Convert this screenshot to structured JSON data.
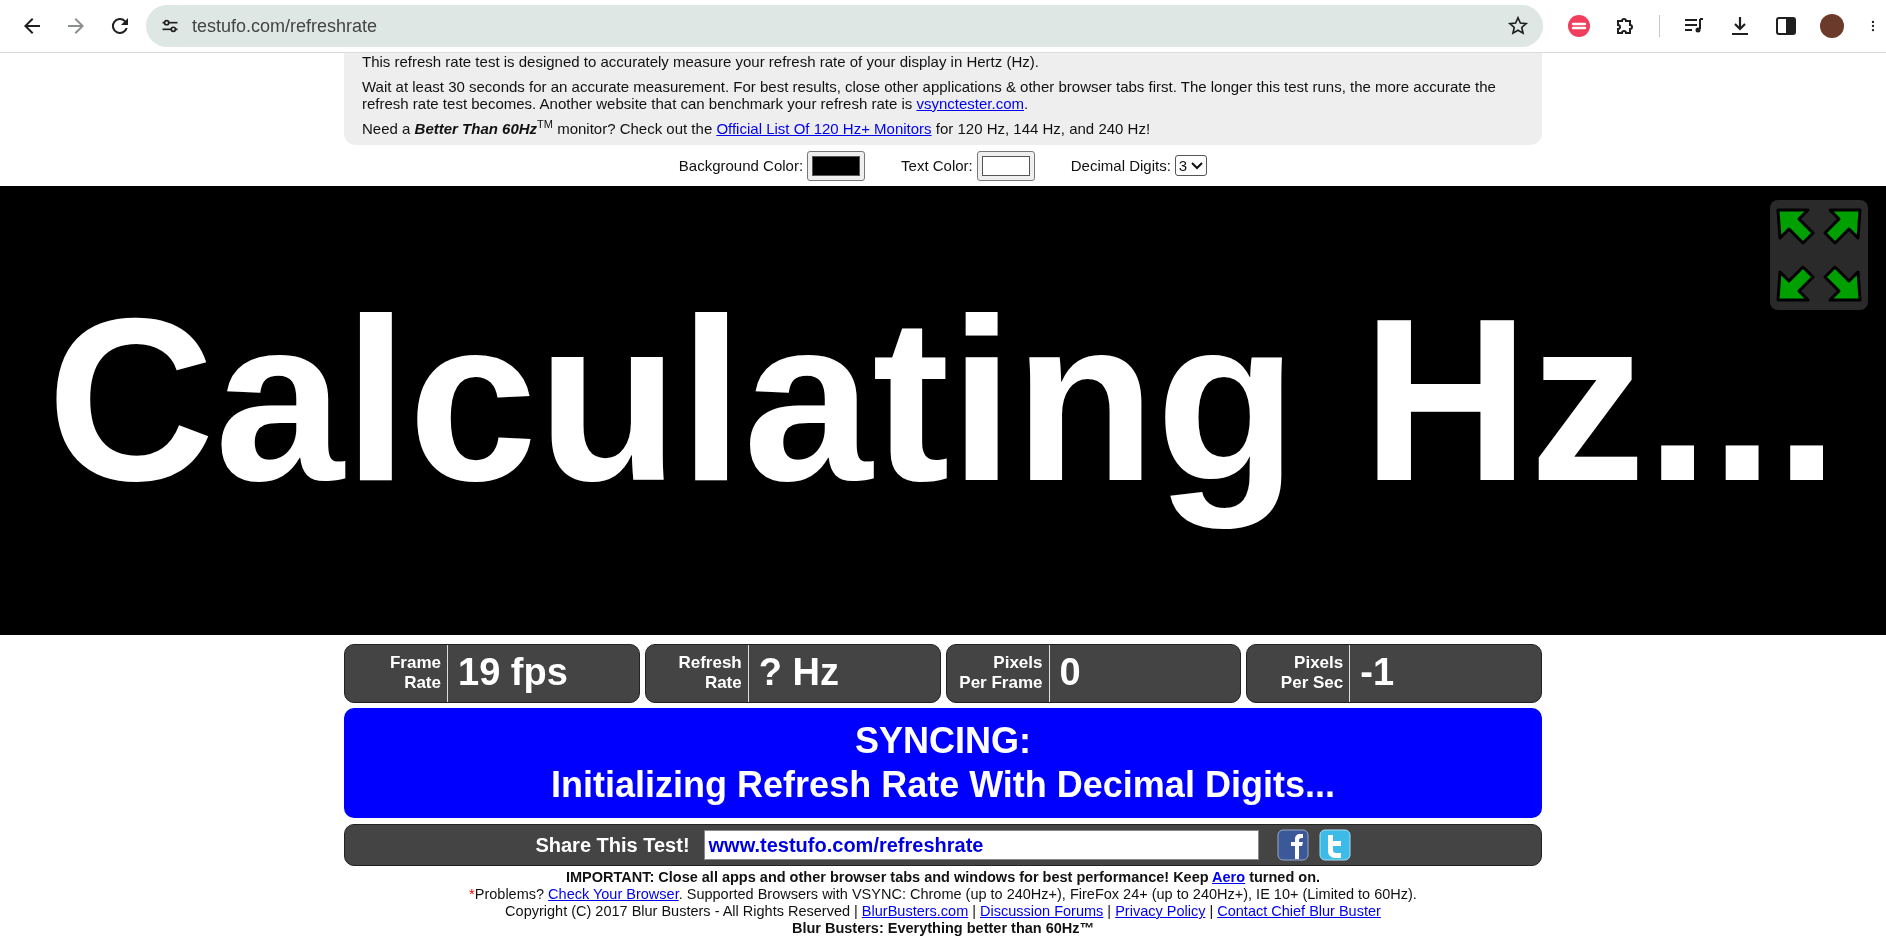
{
  "browser": {
    "url": "testufo.com/refreshrate"
  },
  "intro": {
    "paragraphs": [
      [
        {
          "kind": "plain",
          "text": "This refresh rate test is designed to accurately measure your refresh rate of your display in Hertz (Hz)."
        }
      ],
      [
        {
          "kind": "plain",
          "text": "Wait at least 30 seconds for an accurate measurement. For best results, close other applications & other browser tabs first. The longer this test runs, the more accurate the refresh rate test becomes. Another website that can benchmark your refresh rate is "
        },
        {
          "kind": "link",
          "text": "vsynctester.com"
        },
        {
          "kind": "plain",
          "text": "."
        }
      ],
      [
        {
          "kind": "plain",
          "text": "Need a "
        },
        {
          "kind": "bolditalic",
          "text": "Better Than 60Hz"
        },
        {
          "kind": "sup",
          "text": "TM"
        },
        {
          "kind": "plain",
          "text": " monitor? Check out the "
        },
        {
          "kind": "link",
          "text": "Official List Of 120 Hz+ Monitors"
        },
        {
          "kind": "plain",
          "text": " for 120 Hz, 144 Hz, and 240 Hz!"
        }
      ]
    ]
  },
  "options": [
    {
      "kind": "color",
      "label": "Background Color:",
      "color": "#000000"
    },
    {
      "kind": "color",
      "label": "Text Color:",
      "color": "#ffffff"
    },
    {
      "kind": "select",
      "label": "Decimal Digits:",
      "value": "3"
    }
  ],
  "stage": {
    "text": "Calculating Hz..."
  },
  "stats": [
    {
      "label": [
        "Frame",
        "Rate"
      ],
      "value": "19 fps"
    },
    {
      "label": [
        "Refresh",
        "Rate"
      ],
      "value": "? Hz"
    },
    {
      "label": [
        "Pixels",
        "Per Frame"
      ],
      "value": "0"
    },
    {
      "label": [
        "Pixels",
        "Per Sec"
      ],
      "value": "-1"
    }
  ],
  "status": {
    "title": "SYNCING:",
    "message": "Initializing Refresh Rate With Decimal Digits..."
  },
  "share": {
    "label": "Share This Test!",
    "url": "www.testufo.com/refreshrate"
  },
  "footer": [
    {
      "kind": "bold",
      "segments": [
        {
          "kind": "plain",
          "text": "IMPORTANT: Close all apps and other browser tabs and windows for best performance! Keep "
        },
        {
          "kind": "link",
          "text": "Aero"
        },
        {
          "kind": "plain",
          "text": " turned on."
        }
      ]
    },
    {
      "kind": "plain",
      "segments": [
        {
          "kind": "alert",
          "text": "*"
        },
        {
          "kind": "plain",
          "text": "Problems? "
        },
        {
          "kind": "link",
          "text": "Check Your Browser"
        },
        {
          "kind": "plain",
          "text": ". Supported Browsers with VSYNC: Chrome (up to 240Hz+), FireFox 24+ (up to 240Hz+), IE 10+ (Limited to 60Hz)."
        }
      ]
    },
    {
      "kind": "plain",
      "segments": [
        {
          "kind": "plain",
          "text": "Copyright (C) 2017 Blur Busters - All Rights Reserved | "
        },
        {
          "kind": "link",
          "text": "BlurBusters.com"
        },
        {
          "kind": "plain",
          "text": " | "
        },
        {
          "kind": "link",
          "text": "Discussion Forums"
        },
        {
          "kind": "plain",
          "text": " | "
        },
        {
          "kind": "link",
          "text": "Privacy Policy"
        },
        {
          "kind": "plain",
          "text": " | "
        },
        {
          "kind": "link",
          "text": "Contact Chief Blur Buster"
        }
      ]
    },
    {
      "kind": "bold",
      "segments": [
        {
          "kind": "plain",
          "text": "Blur Busters: Everything better than 60Hz™"
        }
      ]
    }
  ]
}
